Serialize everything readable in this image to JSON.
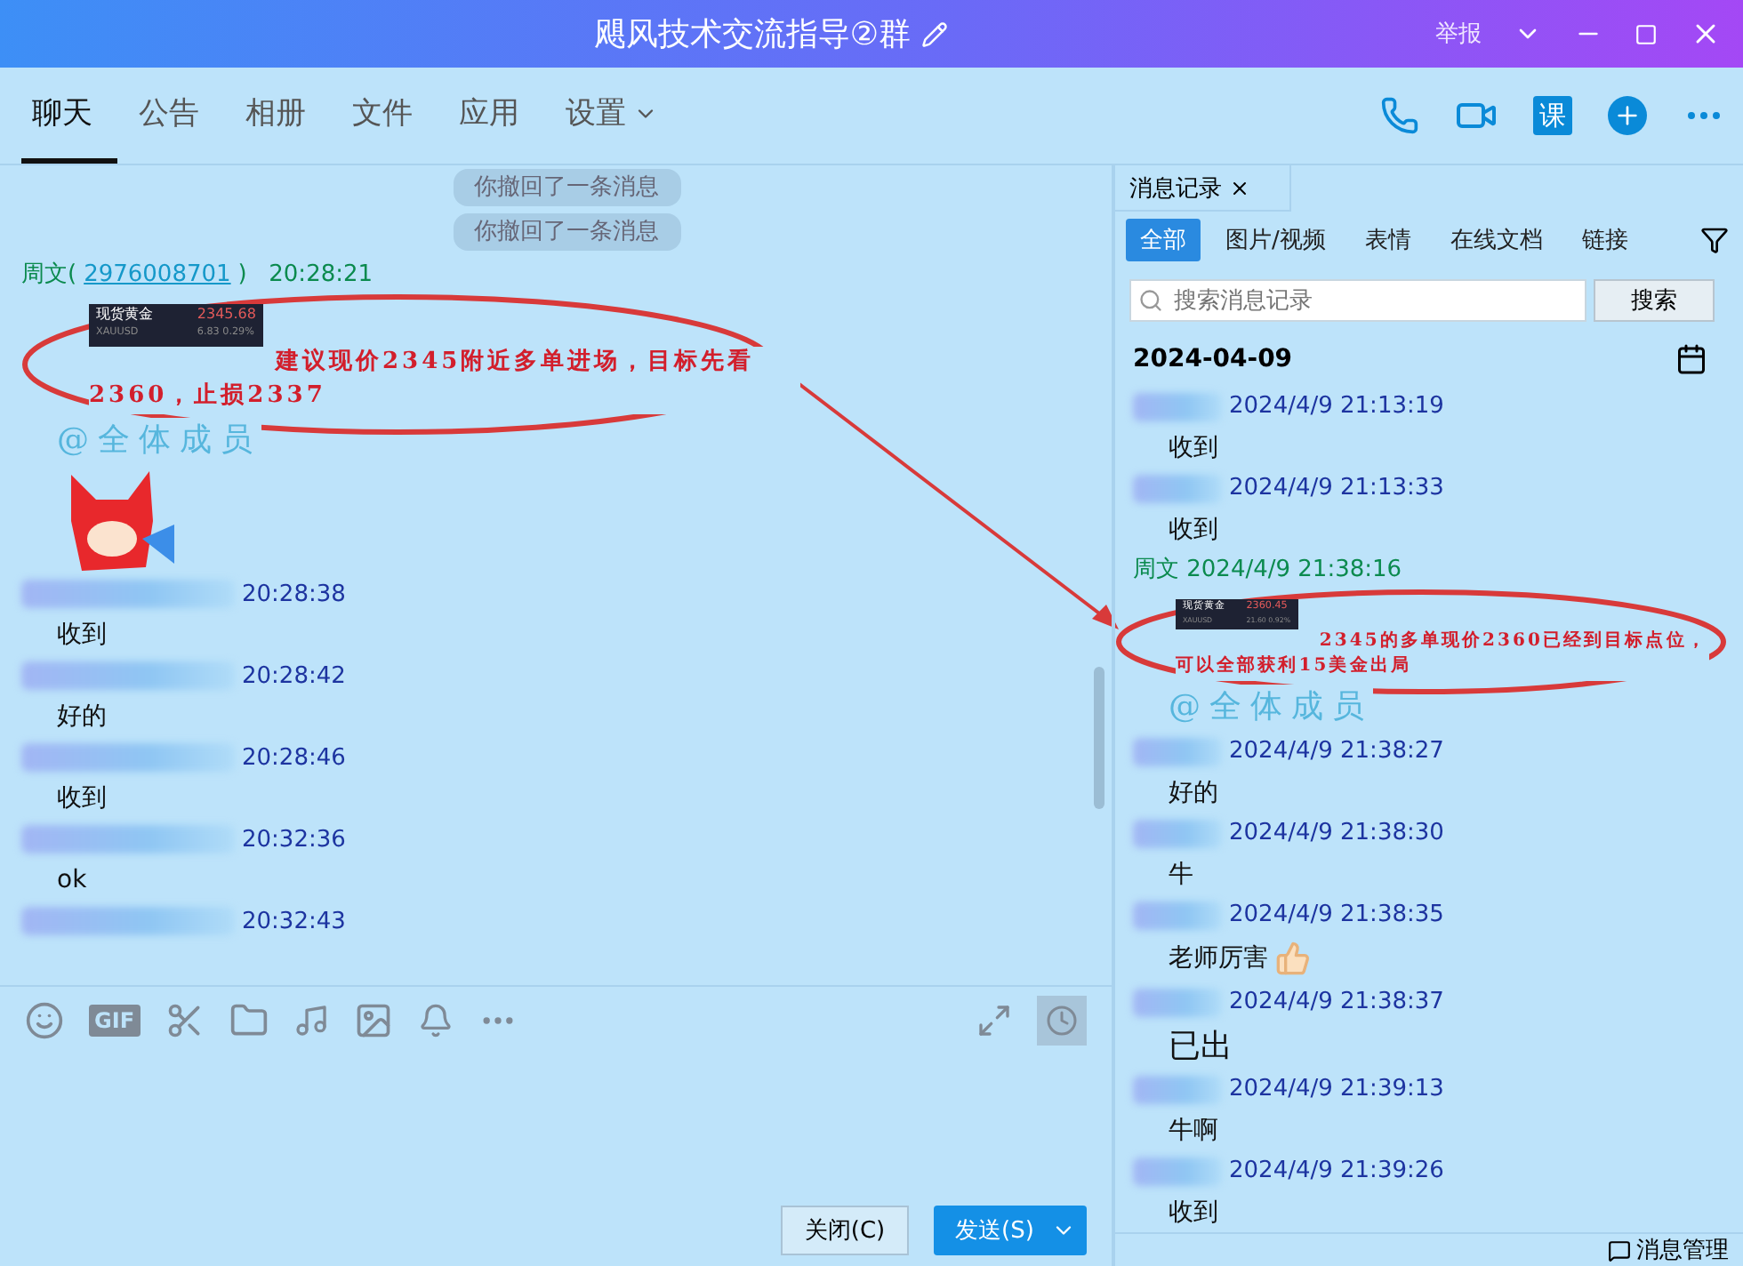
{
  "window": {
    "title": "飓风技术交流指导②群",
    "report": "举报"
  },
  "tabs": [
    {
      "label": "聊天",
      "selected": true,
      "kind": "plain"
    },
    {
      "label": "公告",
      "selected": false,
      "kind": "plain"
    },
    {
      "label": "相册",
      "selected": false,
      "kind": "plain"
    },
    {
      "label": "文件",
      "selected": false,
      "kind": "plain"
    },
    {
      "label": "应用",
      "selected": false,
      "kind": "plain"
    },
    {
      "label": "设置",
      "selected": false,
      "kind": "menu"
    }
  ],
  "header_actions": {
    "lesson": "课"
  },
  "chat": {
    "messages": [
      {
        "kind": "recall",
        "text": "你撤回了一条消息"
      },
      {
        "kind": "recall",
        "text": "你撤回了一条消息"
      },
      {
        "kind": "sender",
        "name": "周文",
        "brackets": [
          "(",
          ")"
        ],
        "id": "2976008701",
        "time": "20:28:21"
      },
      {
        "kind": "quote",
        "card": {
          "title": "现货黄金",
          "price": "2345.68",
          "symbol": "XAUUSD",
          "change": "6.83",
          "pct": "0.29%"
        },
        "text": "建议现价2345附近多单进场，目标先看2360，止损2337"
      },
      {
        "kind": "mention",
        "text": "@全体成员"
      },
      {
        "kind": "sticker"
      },
      {
        "kind": "anon",
        "time": "20:28:38"
      },
      {
        "kind": "text",
        "text": "收到"
      },
      {
        "kind": "anon",
        "time": "20:28:42"
      },
      {
        "kind": "text",
        "text": "好的"
      },
      {
        "kind": "anon",
        "time": "20:28:46"
      },
      {
        "kind": "text",
        "text": "收到"
      },
      {
        "kind": "anon",
        "time": "20:32:36"
      },
      {
        "kind": "text",
        "text": "ok"
      },
      {
        "kind": "anon",
        "time": "20:32:43"
      }
    ]
  },
  "toolbar": {
    "gif": "GIF"
  },
  "buttons": {
    "close": "关闭(C)",
    "send": "发送(S)"
  },
  "history": {
    "tab": "消息记录",
    "filters": [
      {
        "label": "全部",
        "selected": true
      },
      {
        "label": "图片/视频",
        "selected": false
      },
      {
        "label": "表情",
        "selected": false
      },
      {
        "label": "在线文档",
        "selected": false
      },
      {
        "label": "链接",
        "selected": false
      }
    ],
    "search": {
      "placeholder": "搜索消息记录",
      "button": "搜索"
    },
    "date": "2024-04-09",
    "messages": [
      {
        "kind": "anon",
        "time": "2024/4/9 21:13:19"
      },
      {
        "kind": "text",
        "text": "收到"
      },
      {
        "kind": "anon",
        "time": "2024/4/9 21:13:33"
      },
      {
        "kind": "text",
        "text": "收到"
      },
      {
        "kind": "sender",
        "name": "周文",
        "time": "2024/4/9 21:38:16"
      },
      {
        "kind": "quote",
        "card": {
          "title": "现货黄金",
          "price": "2360.45",
          "symbol": "XAUUSD",
          "change": "21.60",
          "pct": "0.92%"
        },
        "text": "2345的多单现价2360已经到目标点位，可以全部获利15美金出局"
      },
      {
        "kind": "mention",
        "text": "@全体成员"
      },
      {
        "kind": "anon",
        "time": "2024/4/9 21:38:27"
      },
      {
        "kind": "text",
        "text": "好的"
      },
      {
        "kind": "anon",
        "time": "2024/4/9 21:38:30"
      },
      {
        "kind": "text",
        "text": "牛"
      },
      {
        "kind": "anon",
        "time": "2024/4/9 21:38:35"
      },
      {
        "kind": "thumb",
        "text": "老师厉害"
      },
      {
        "kind": "anon",
        "time": "2024/4/9 21:38:37"
      },
      {
        "kind": "big",
        "text": "已出"
      },
      {
        "kind": "anon",
        "time": "2024/4/9 21:39:13"
      },
      {
        "kind": "text",
        "text": "牛啊"
      },
      {
        "kind": "anon",
        "time": "2024/4/9 21:39:26"
      },
      {
        "kind": "text",
        "text": "收到"
      }
    ],
    "manage": "消息管理"
  }
}
